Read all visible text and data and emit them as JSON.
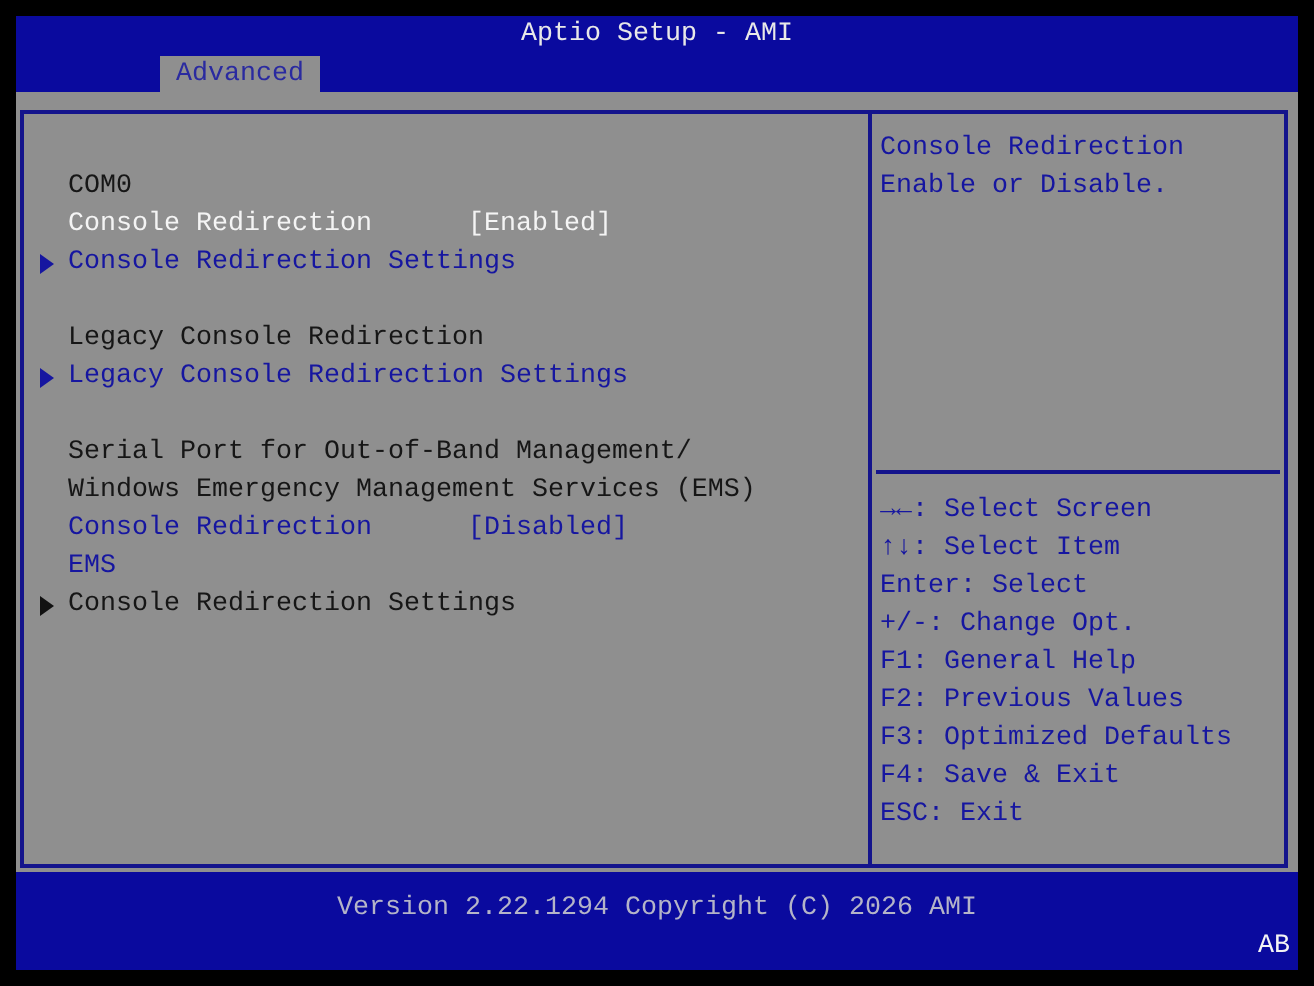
{
  "window": {
    "title": "Aptio Setup - AMI"
  },
  "tabs": [
    {
      "label": "Advanced",
      "selected": true
    }
  ],
  "groups": [
    {
      "items": [
        {
          "kind": "heading",
          "label": "COM0"
        },
        {
          "kind": "option",
          "label": "Console Redirection",
          "value": "[Enabled]",
          "selected": true
        },
        {
          "kind": "submenu",
          "label": "Console Redirection Settings",
          "disabled": false
        }
      ]
    },
    {
      "items": [
        {
          "kind": "heading",
          "label": "Legacy Console Redirection"
        },
        {
          "kind": "submenu",
          "label": "Legacy Console Redirection Settings",
          "disabled": false
        }
      ]
    },
    {
      "items": [
        {
          "kind": "heading",
          "label": "Serial Port for Out-of-Band Management/"
        },
        {
          "kind": "heading",
          "label": "Windows Emergency Management Services (EMS)"
        },
        {
          "kind": "option",
          "label": "Console Redirection",
          "value": "[Disabled]",
          "selected": false
        },
        {
          "kind": "option",
          "label": "EMS",
          "selected": false
        },
        {
          "kind": "submenu",
          "label": "Console Redirection Settings",
          "disabled": true
        }
      ]
    }
  ],
  "help": [
    "Console Redirection",
    "Enable or Disable."
  ],
  "keys": [
    "→←: Select Screen",
    "↑↓: Select Item",
    "Enter: Select",
    "+/-: Change Opt.",
    "F1: General Help",
    "F2: Previous Values",
    "F3: Optimized Defaults",
    "F4: Save & Exit",
    "ESC: Exit"
  ],
  "status_bar": {
    "version": "Version 2.22.1294 Copyright (C) 2026 AMI",
    "badge": "AB"
  }
}
